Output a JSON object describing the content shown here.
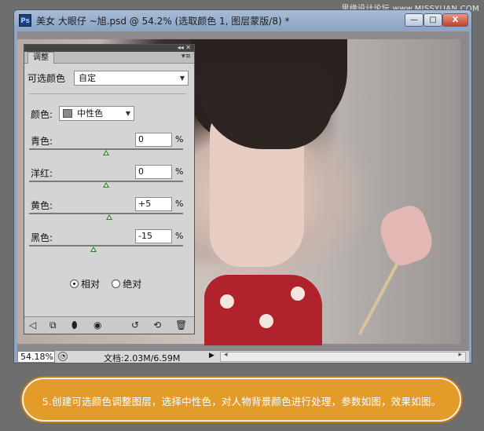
{
  "watermark": "思缘设计论坛 www.MISSYUAN.COM",
  "window": {
    "title": "美女 大眼仔 ~旭.psd @ 54.2% (选取颜色 1, 图层蒙版/8) *",
    "app_icon": "Ps",
    "minimize": "—",
    "maximize": "□",
    "close": "X"
  },
  "panel": {
    "tab": "调整",
    "menu_icon": "menu-icon",
    "collapse_ctrls": "◂◂ ✕",
    "adjustment_label": "可选颜色",
    "preset_value": "自定",
    "color_label": "颜色:",
    "color_value": "中性色",
    "sliders": [
      {
        "label": "青色:",
        "value": "0",
        "pos": 0.5
      },
      {
        "label": "洋红:",
        "value": "0",
        "pos": 0.5
      },
      {
        "label": "黄色:",
        "value": "+5",
        "pos": 0.52
      },
      {
        "label": "黑色:",
        "value": "-15",
        "pos": 0.42
      }
    ],
    "percent": "%",
    "radio_relative": "相对",
    "radio_absolute": "绝对",
    "relative_selected": true
  },
  "statusbar": {
    "zoom": "54.18%",
    "doc_info": "文档:2.03M/6.59M"
  },
  "caption": "5.创建可选颜色调整图层，选择中性色，对人物背景颜色进行处理，参数如图，效果如图。"
}
